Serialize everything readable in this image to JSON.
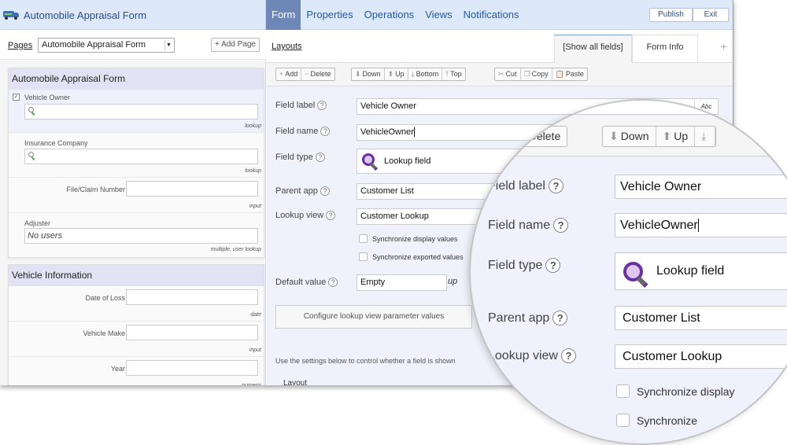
{
  "app": {
    "title": "Automobile Appraisal Form",
    "icon": "truck-icon"
  },
  "nav": {
    "items": [
      {
        "label": "Form",
        "active": true
      },
      {
        "label": "Properties",
        "active": false
      },
      {
        "label": "Operations",
        "active": false
      },
      {
        "label": "Views",
        "active": false
      },
      {
        "label": "Notifications",
        "active": false
      }
    ],
    "publish_label": "Publish",
    "exit_label": "Exit"
  },
  "pages": {
    "label": "Pages",
    "selected": "Automobile Appraisal Form",
    "add_page_label": "+ Add Page"
  },
  "sections": [
    {
      "title": "Automobile Appraisal Form",
      "fields": [
        {
          "label": "Vehicle Owner",
          "type": "lookup",
          "checked": true
        },
        {
          "label": "Insurance Company",
          "type": "lookup"
        },
        {
          "label": "File/Claim Number",
          "type": "input"
        },
        {
          "label": "Adjuster",
          "type": "multiple, user lookup",
          "value": "No users"
        }
      ]
    },
    {
      "title": "Vehicle Information",
      "fields": [
        {
          "label": "Date of Loss",
          "type": "date"
        },
        {
          "label": "Vehicle Make",
          "type": "input"
        },
        {
          "label": "Year",
          "type": "numeric"
        }
      ]
    }
  ],
  "layouts": {
    "label": "Layouts",
    "tabs": [
      {
        "label": "[Show all fields]",
        "active": true
      },
      {
        "label": "Form Info",
        "active": false
      }
    ],
    "add_tab_label": "+"
  },
  "toolbar": {
    "add": "Add",
    "delete": "Delete",
    "down": "Down",
    "up": "Up",
    "bottom": "Bottom",
    "top": "Top",
    "cut": "Cut",
    "copy": "Copy",
    "paste": "Paste"
  },
  "properties": {
    "field_label": {
      "label": "Field label",
      "value": "Vehicle Owner",
      "format_badge": "Abc"
    },
    "field_name": {
      "label": "Field name",
      "value": "VehicleOwner"
    },
    "field_type": {
      "label": "Field type",
      "value": "Lookup field"
    },
    "parent_app": {
      "label": "Parent app",
      "value": "Customer List"
    },
    "lookup_view": {
      "label": "Lookup view",
      "value": "Customer Lookup"
    },
    "sync_display": {
      "label": "Synchronize display values",
      "checked": false
    },
    "sync_exported": {
      "label": "Synchronize exported values",
      "checked": false
    },
    "default_value": {
      "label": "Default value",
      "value": "Empty"
    },
    "configure_button": "Configure lookup view parameter values",
    "note": "Use the settings below to control whether a field is shown",
    "layout_heading": "Layout",
    "help_glyph": "?"
  },
  "magnifier": {
    "toolbar_partial_add": "ad",
    "sync_display_partial": "Synchronize display",
    "sync_exported_partial": "Synchronize",
    "default_partial_suffix": "up"
  }
}
